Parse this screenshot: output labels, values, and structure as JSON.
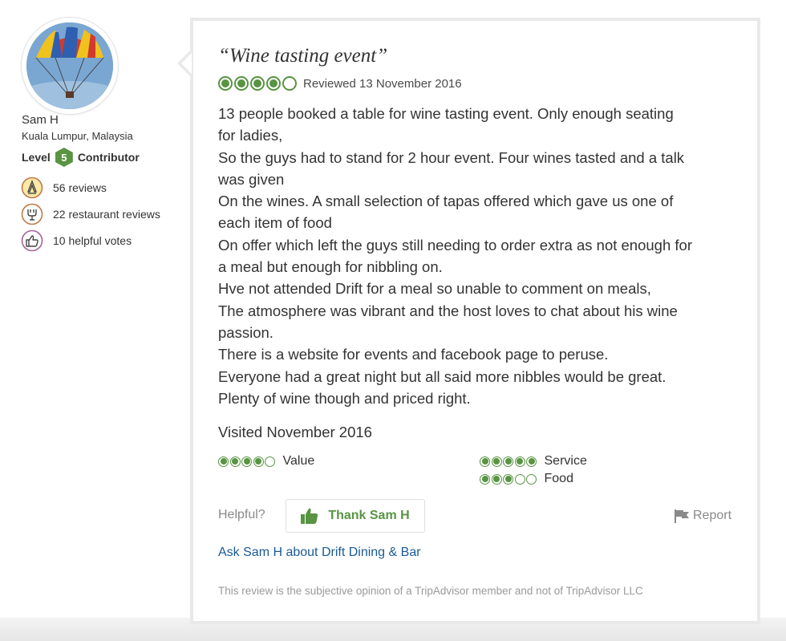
{
  "member": {
    "name": "Sam H",
    "location": "Kuala Lumpur, Malaysia",
    "level_prefix": "Level",
    "level": "5",
    "level_suffix": "Contributor",
    "stats": [
      {
        "icon": "pen-badge-icon",
        "text": "56 reviews"
      },
      {
        "icon": "restaurant-icon",
        "text": "22 restaurant reviews"
      },
      {
        "icon": "thumbs-up-icon",
        "text": "10 helpful votes"
      }
    ]
  },
  "review": {
    "title": "“Wine tasting event”",
    "rating": 4,
    "rating_max": 5,
    "reviewed_date": "Reviewed 13 November 2016",
    "body_lines": [
      "13 people booked a table for wine tasting event. Only enough seating",
      "for ladies,",
      "So the guys had to stand for 2 hour event. Four wines tasted and a talk",
      "was given",
      "On the wines. A small selection of tapas offered which gave us one of",
      "each item of food",
      "On offer which left the guys still needing to order extra as not enough for",
      "a meal but enough for nibbling on.",
      "Hve not attended Drift for a meal so unable to comment on meals,",
      "The atmosphere was vibrant and the host loves to chat about his wine",
      "passion.",
      "There is a website for events and facebook page to peruse.",
      "Everyone had a great night but all said more nibbles would be great.",
      "Plenty of wine though and priced right."
    ],
    "visited": "Visited November 2016",
    "sub_ratings": [
      {
        "label": "Value",
        "rating": 4
      },
      {
        "label": "Service",
        "rating": 5
      },
      {
        "label": "Food",
        "rating": 3
      }
    ]
  },
  "actions": {
    "helpful_label": "Helpful?",
    "thank_label": "Thank Sam H",
    "report_label": "Report",
    "ask_link": "Ask Sam H about Drift Dining & Bar"
  },
  "disclaimer": "This review is the subjective opinion of a TripAdvisor member and not of TripAdvisor LLC",
  "colors": {
    "accent_green": "#589442",
    "link_blue": "#1a5a96",
    "muted_gray": "#8a8a8a"
  }
}
